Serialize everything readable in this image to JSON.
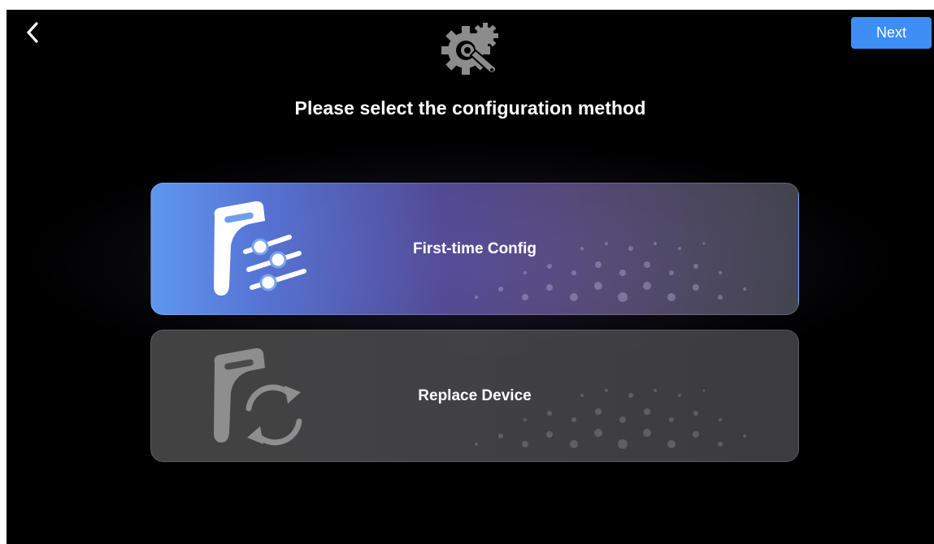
{
  "header": {
    "back_icon": "chevron-left-icon",
    "next_label": "Next",
    "config_icon": "gear-wrench-icon",
    "title": "Please select the configuration method"
  },
  "options": [
    {
      "label": "First-time Config",
      "icon": "document-sliders-icon",
      "selected": true
    },
    {
      "label": "Replace Device",
      "icon": "document-refresh-icon",
      "selected": false
    }
  ],
  "colors": {
    "accent": "#3d8ef5",
    "background": "#000000",
    "selected_option": "#5f96f0",
    "unselected_option": "#464646"
  }
}
